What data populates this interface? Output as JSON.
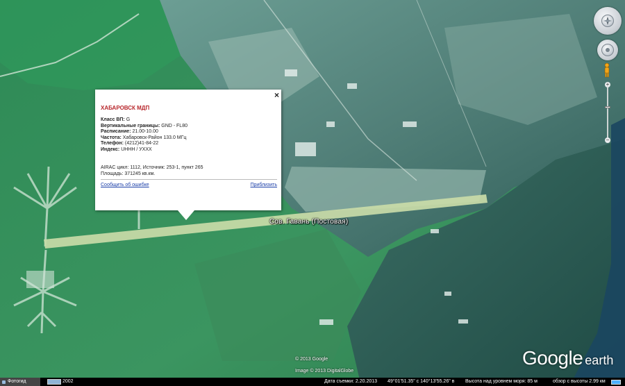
{
  "popup": {
    "title": "ХАБАРОВСК МДП",
    "rows": [
      {
        "label": "Класс ВП:",
        "value": "G"
      },
      {
        "label": "Вертикальные границы:",
        "value": "GND - FL80"
      },
      {
        "label": "Расписание:",
        "value": "21.00-10.00"
      },
      {
        "label": "Частота:",
        "value": "Хабаровск-Район 133.0 МГц"
      },
      {
        "label": "Телефон:",
        "value": "(4212)41-84-22"
      },
      {
        "label": "Индекс:",
        "value": "UHHH / УХХХ"
      }
    ],
    "airac_line": "AIRAC цикл: 1112, Источник: 253-1, пункт 265",
    "area_line": "Площадь: 371245 кв.км.",
    "report_link": "Сообщить об ошибке",
    "zoom_link": "Приблизить",
    "close_label": "×"
  },
  "map": {
    "place_label": "Сов. Гавань (Постовая)",
    "copyright_line1": "© 2013 Google",
    "copyright_line2": "Image © 2013 DigitalGlobe",
    "logo_google": "Google",
    "logo_earth": "earth"
  },
  "controls": {
    "zoom_in": "+",
    "zoom_out": "−",
    "zoom_level": 0.4
  },
  "statusbar": {
    "tab_label": "Фотогид",
    "history_year": "2002",
    "date": "Дата съемки: 2.20.2013",
    "coords": "49°01'51.35\" с  140°13'55.26\" в",
    "elevation": "Высота над уровнем моря:  85 м",
    "eye_alt": "обзор с высоты  2.99 км",
    "stream_progress": 1.0
  },
  "colors": {
    "popup_title": "#b8282d",
    "link": "#1a3ea8",
    "runway": "#c9dba8"
  }
}
